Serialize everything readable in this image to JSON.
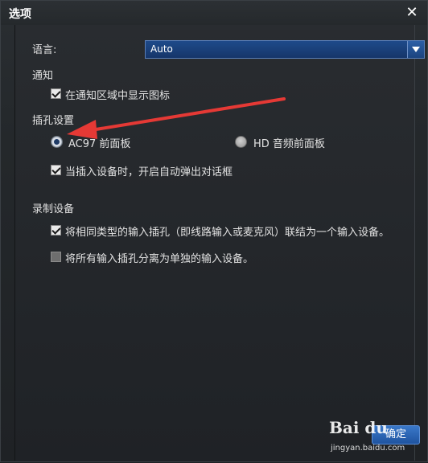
{
  "window": {
    "title": "选项",
    "close_glyph": "✕"
  },
  "language": {
    "label": "语言:",
    "value": "Auto"
  },
  "notify": {
    "section": "通知",
    "show_tray_icon": {
      "label": "在通知区域中显示图标",
      "checked": true
    }
  },
  "jack": {
    "section": "插孔设置",
    "radio_ac97": {
      "label": "AC97 前面板",
      "selected": true
    },
    "radio_hd": {
      "label": "HD 音频前面板",
      "selected": false
    },
    "popup_dialog": {
      "label": "当插入设备时，开启自动弹出对话框",
      "checked": true
    }
  },
  "recording": {
    "section": "录制设备",
    "combine": {
      "label": "将相同类型的输入插孔（即线路输入或麦克风）联结为一个输入设备。",
      "checked": true
    },
    "separate": {
      "label": "将所有输入插孔分离为单独的输入设备。",
      "checked": false
    }
  },
  "footer": {
    "confirm_label": "确定"
  },
  "watermark": {
    "logo": "Bai du",
    "url": "jingyan.baidu.com"
  },
  "colors": {
    "accent": "#1e4a8a",
    "annotation_arrow": "#e53935"
  }
}
